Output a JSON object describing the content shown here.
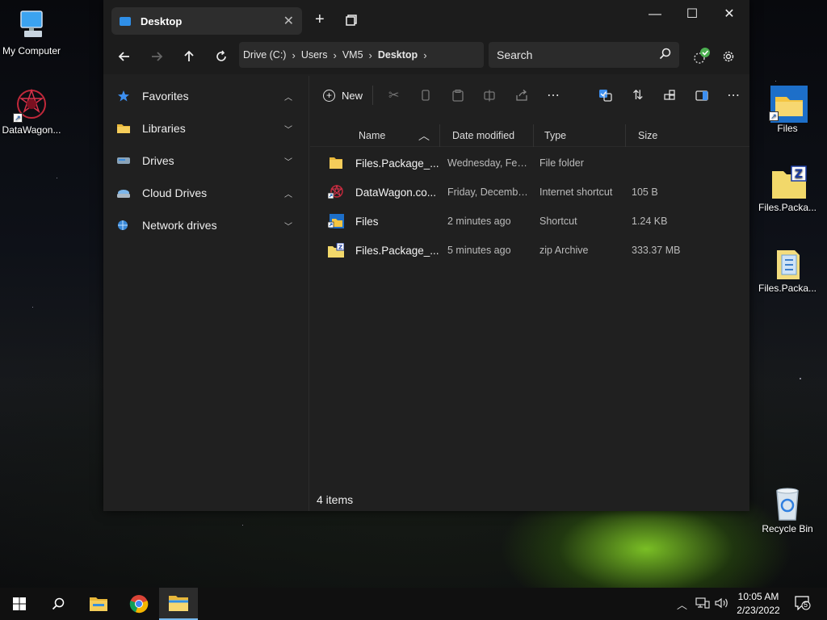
{
  "desktop": {
    "icons": [
      {
        "label": "My Computer",
        "icon": "computer-icon"
      },
      {
        "label": "DataWagon...",
        "icon": "datawagon-icon"
      },
      {
        "label": "Files",
        "icon": "files-app-icon"
      },
      {
        "label": "Files.Packa...",
        "icon": "zip-archive-icon"
      },
      {
        "label": "Files.Packa...",
        "icon": "package-icon"
      },
      {
        "label": "Recycle Bin",
        "icon": "recycle-bin-icon"
      }
    ]
  },
  "window": {
    "tab": {
      "title": "Desktop",
      "close": "✕"
    },
    "new_tab": "+",
    "controls": {
      "minimize": "—",
      "maximize": "☐",
      "close": "✕"
    },
    "address": {
      "crumbs": [
        "Drive (C:)",
        "Users",
        "VM5",
        "Desktop"
      ]
    },
    "search": {
      "placeholder": "Search"
    },
    "sidebar": {
      "items": [
        {
          "label": "Favorites",
          "chevron": "up",
          "icon": "star-icon"
        },
        {
          "label": "Libraries",
          "chevron": "down",
          "icon": "library-icon"
        },
        {
          "label": "Drives",
          "chevron": "down",
          "icon": "drive-icon"
        },
        {
          "label": "Cloud Drives",
          "chevron": "up",
          "icon": "cloud-drive-icon"
        },
        {
          "label": "Network drives",
          "chevron": "down",
          "icon": "network-icon"
        }
      ]
    },
    "toolbar": {
      "new_label": "New"
    },
    "columns": {
      "name": "Name",
      "date": "Date modified",
      "type": "Type",
      "size": "Size"
    },
    "files": [
      {
        "name": "Files.Package_...",
        "date": "Wednesday, Febr...",
        "type": "File folder",
        "size": "",
        "icon": "folder-icon"
      },
      {
        "name": "DataWagon.co...",
        "date": "Friday, December...",
        "type": "Internet shortcut",
        "size": "105 B",
        "icon": "internet-shortcut-icon"
      },
      {
        "name": "Files",
        "date": "2 minutes ago",
        "type": "Shortcut",
        "size": "1.24 KB",
        "icon": "shortcut-icon"
      },
      {
        "name": "Files.Package_...",
        "date": "5 minutes ago",
        "type": "zip Archive",
        "size": "333.37 MB",
        "icon": "zip-icon"
      }
    ],
    "status": "4 items"
  },
  "taskbar": {
    "time": "10:05 AM",
    "date": "2/23/2022",
    "notification_count": "5"
  },
  "colors": {
    "accent": "#2f8fe8",
    "window_bg": "#202020",
    "taskbar_bg": "#101010"
  }
}
